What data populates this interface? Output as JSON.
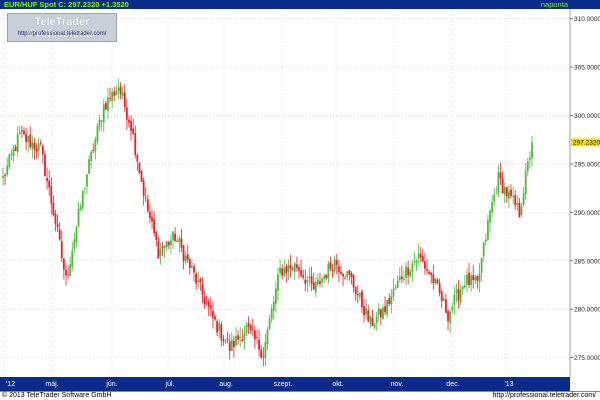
{
  "header": {
    "symbol_line": "EUR/HUF Spot C: 297.2320 +1.3520",
    "period": "naponta"
  },
  "branding": {
    "title": "TeleTrader Professional",
    "url": "http://professional.teletrader.com/"
  },
  "footer": {
    "copyright": "© 2013 TeleTrader Software GmbH",
    "url": "http://professional.teletrader.com/"
  },
  "colors": {
    "background": "#ffffff",
    "up": "#4cbb3c",
    "down": "#e8202a",
    "grid": "#c8c8c8",
    "axis_panel": "#0a2a8c",
    "last_price_tag": "#f5e600"
  },
  "chart_data": {
    "type": "candlestick",
    "title": "EUR/HUF Spot",
    "ylim": [
      273,
      311
    ],
    "y_ticks": [
      "310.0000",
      "305.0000",
      "300.0000",
      "295.0000",
      "290.0000",
      "285.0000",
      "280.0000",
      "275.0000"
    ],
    "x_ticks": [
      "'12",
      "máj.",
      "jún.",
      "júl.",
      "aug.",
      "szept.",
      "okt.",
      "nov.",
      "dec.",
      "'13"
    ],
    "last_value": "297.2320",
    "grid": true,
    "waypoints": [
      [
        0,
        293.5
      ],
      [
        8,
        298.0
      ],
      [
        18,
        296.5
      ],
      [
        25,
        289.0
      ],
      [
        30,
        283.0
      ],
      [
        40,
        294.0
      ],
      [
        48,
        301.0
      ],
      [
        55,
        303.0
      ],
      [
        61,
        299.0
      ],
      [
        68,
        291.0
      ],
      [
        74,
        286.0
      ],
      [
        82,
        287.5
      ],
      [
        90,
        284.0
      ],
      [
        100,
        279.0
      ],
      [
        108,
        276.0
      ],
      [
        116,
        278.0
      ],
      [
        124,
        275.5
      ],
      [
        132,
        284.0
      ],
      [
        140,
        284.5
      ],
      [
        148,
        282.0
      ],
      [
        158,
        285.0
      ],
      [
        166,
        283.0
      ],
      [
        175,
        278.5
      ],
      [
        182,
        280.0
      ],
      [
        190,
        283.5
      ],
      [
        198,
        285.5
      ],
      [
        205,
        283.0
      ],
      [
        212,
        279.5
      ],
      [
        220,
        283.0
      ],
      [
        226,
        282.5
      ],
      [
        232,
        290.0
      ],
      [
        236,
        293.5
      ],
      [
        240,
        292.0
      ],
      [
        246,
        290.0
      ],
      [
        252,
        297.2
      ]
    ]
  }
}
